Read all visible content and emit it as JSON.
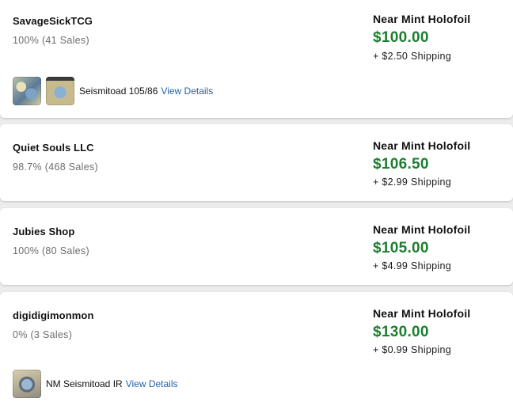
{
  "listings": [
    {
      "seller": "SavageSickTCG",
      "rating": "100%",
      "sales": "(41 Sales)",
      "condition": "Near Mint Holofoil",
      "price": "$100.00",
      "shipping": "+ $2.50 Shipping",
      "photo_caption": "Seismitoad 105/86",
      "view_details": "View Details"
    },
    {
      "seller": "Quiet Souls LLC",
      "rating": "98.7%",
      "sales": "(468 Sales)",
      "condition": "Near Mint Holofoil",
      "price": "$106.50",
      "shipping": "+ $2.99 Shipping"
    },
    {
      "seller": "Jubies Shop",
      "rating": "100%",
      "sales": "(80 Sales)",
      "condition": "Near Mint Holofoil",
      "price": "$105.00",
      "shipping": "+ $4.99 Shipping"
    },
    {
      "seller": "digidigimonmon",
      "rating": "0%",
      "sales": "(3 Sales)",
      "condition": "Near Mint Holofoil",
      "price": "$130.00",
      "shipping": "+ $0.99 Shipping",
      "photo_caption": "NM Seismitoad IR",
      "view_details": "View Details"
    }
  ],
  "colors": {
    "price": "#1a7f2e",
    "link": "#1f62a8",
    "muted": "#6d6d6d",
    "background": "#ececec"
  }
}
